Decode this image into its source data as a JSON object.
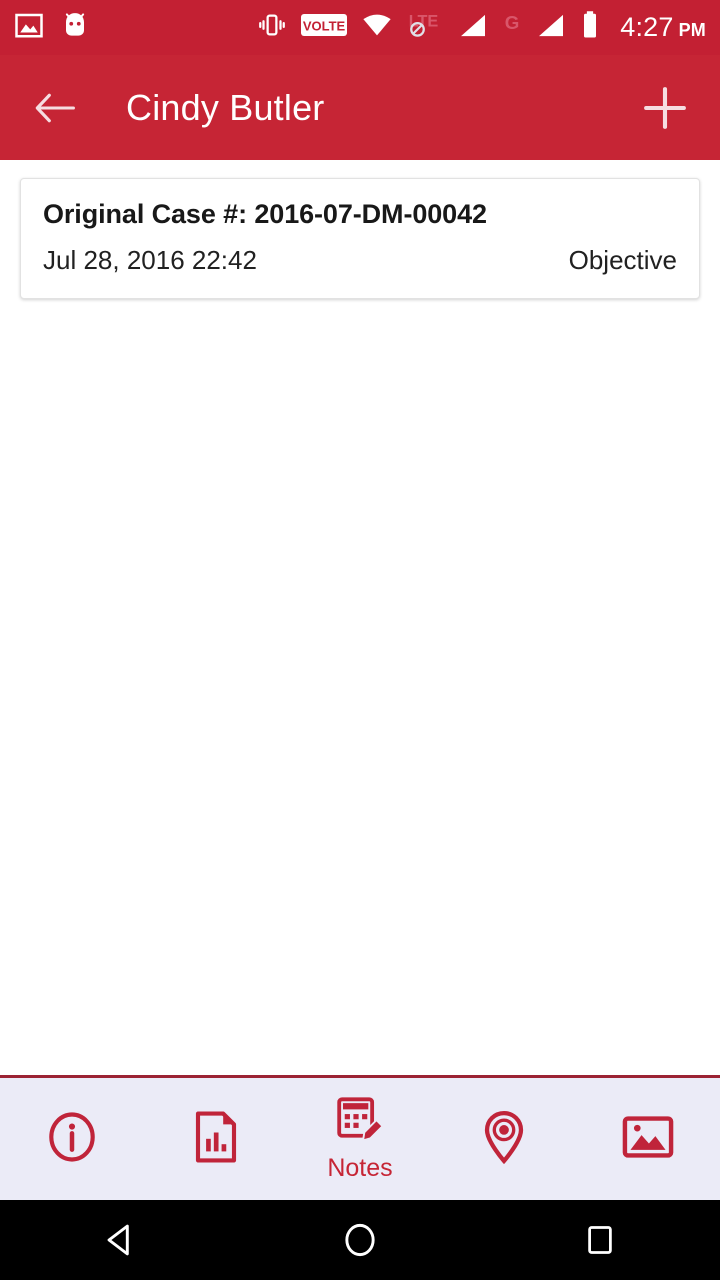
{
  "status_bar": {
    "background": "#C32033",
    "left_icons": [
      {
        "name": "screenshot-image-icon",
        "label": "screenshot"
      },
      {
        "name": "android-head-icon",
        "label": "android-system"
      }
    ],
    "right_icons": [
      {
        "name": "vibrate-icon",
        "label": "vibrate"
      },
      {
        "name": "volte-icon",
        "label": "VOLTE"
      },
      {
        "name": "wifi-icon",
        "label": "wifi"
      },
      {
        "name": "lte-disabled-icon",
        "label": "LTE"
      },
      {
        "name": "signal-bars-sim1-icon",
        "label": "signal-1"
      },
      {
        "name": "network-g-icon",
        "label": "G"
      },
      {
        "name": "signal-bars-sim2-icon",
        "label": "signal-2"
      },
      {
        "name": "battery-icon",
        "label": "battery"
      }
    ],
    "time": "4:27",
    "ampm": "PM"
  },
  "app_bar": {
    "background": "#C62535",
    "title": "Cindy Butler",
    "back_label": "Back",
    "add_label": "Add"
  },
  "content": {
    "card": {
      "case_title": "Original Case #: 2016-07-DM-00042",
      "date": "Jul 28, 2016 22:42",
      "type": "Objective"
    }
  },
  "bottom_nav": {
    "background": "#EBEBF7",
    "accent": "#C62535",
    "divider": "#9B2233",
    "items": [
      {
        "name": "nav-info",
        "icon": "info-circle-icon",
        "label": "",
        "active": false
      },
      {
        "name": "nav-reports",
        "icon": "report-doc-icon",
        "label": "",
        "active": false
      },
      {
        "name": "nav-notes",
        "icon": "notes-pencil-icon",
        "label": "Notes",
        "active": true
      },
      {
        "name": "nav-location",
        "icon": "map-pin-icon",
        "label": "",
        "active": false
      },
      {
        "name": "nav-photos",
        "icon": "photo-image-icon",
        "label": "",
        "active": false
      }
    ]
  },
  "android_nav": {
    "background": "#000000",
    "buttons": [
      {
        "name": "android-back-button",
        "icon": "triangle-back-icon",
        "label": "Back"
      },
      {
        "name": "android-home-button",
        "icon": "circle-home-icon",
        "label": "Home"
      },
      {
        "name": "android-recents-button",
        "icon": "square-recents-icon",
        "label": "Recents"
      }
    ]
  }
}
